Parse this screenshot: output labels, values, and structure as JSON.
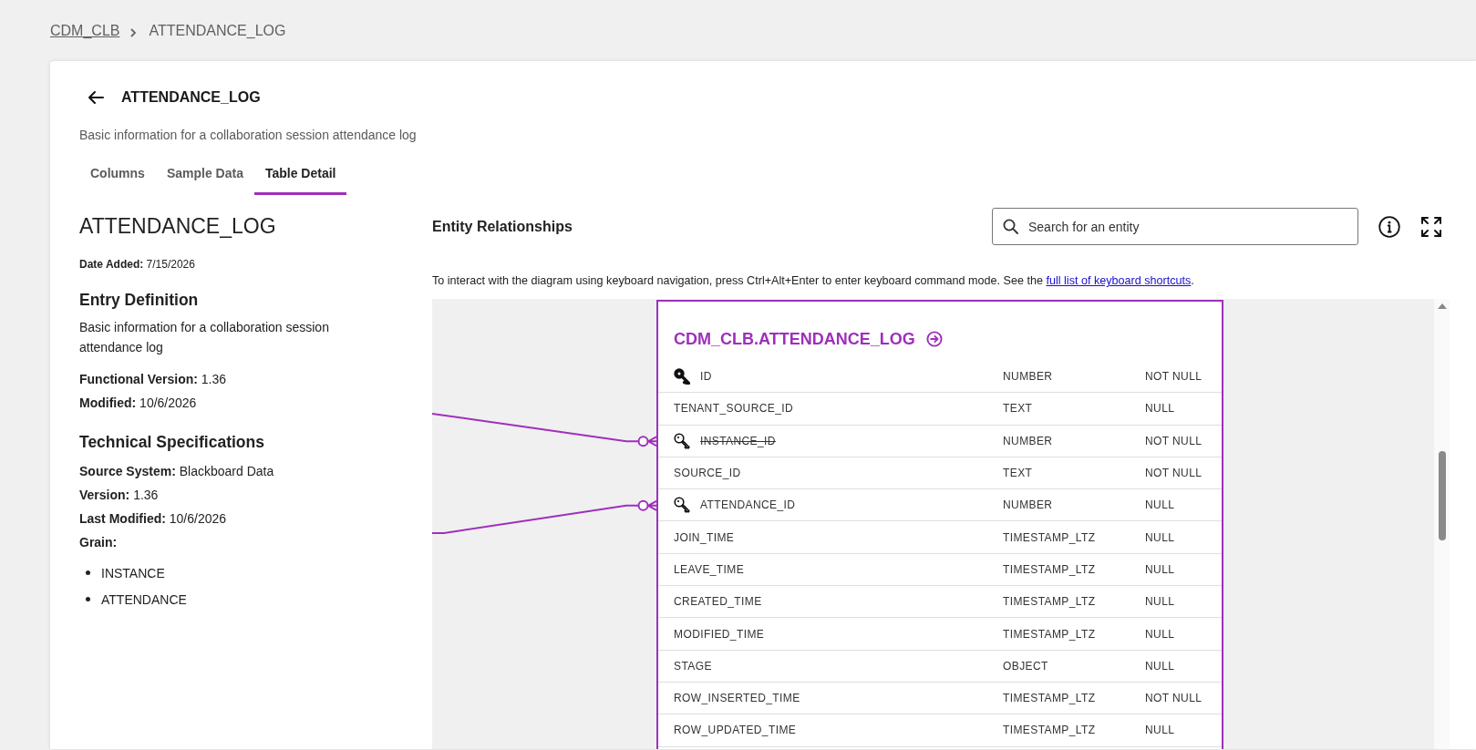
{
  "breadcrumb": [
    {
      "label": "CDM_CLB",
      "kind": "link"
    },
    {
      "label": "ATTENDANCE_LOG",
      "kind": "current"
    }
  ],
  "header": {
    "title": "ATTENDANCE_LOG",
    "description": "Basic information for a collaboration session attendance log"
  },
  "tabs": [
    {
      "label": "Columns",
      "selected": false
    },
    {
      "label": "Sample Data",
      "selected": false
    },
    {
      "label": "Table Detail",
      "selected": true
    }
  ],
  "details": {
    "title": "ATTENDANCE_LOG",
    "date_added": "**Date Added:** 7/15/2026",
    "sections": [
      {
        "heading": "Entry Definition",
        "description": "Basic information for a collaboration session attendance log",
        "fields": [
          "**Functional Version:** 1.36",
          "**Modified:** 10/6/2026"
        ]
      },
      {
        "heading": "Technical Specifications",
        "fields": [
          "**Source System:** Blackboard Data",
          "**Version:** 1.36",
          "**Last Modified:** 10/6/2026"
        ],
        "list_label": "Grain:",
        "list": [
          "INSTANCE",
          "ATTENDANCE"
        ]
      }
    ]
  },
  "entity_relationships": {
    "title": "Entity Relationships",
    "search": {
      "placeholder": "Search for an entity"
    },
    "instructions": "To interact with the diagram using keyboard navigation, press Ctrl+Alt+Enter to enter keyboard command mode. See the ",
    "instructions_link": "full list of keyboard shortcuts",
    "instructions_end": ".",
    "entity": {
      "title": "CDM_CLB.ATTENDANCE_LOG",
      "columns": [
        {
          "name": "ID",
          "type": "NUMBER",
          "nullability": "NOT NULL",
          "kind": "primary-key",
          "struck": false
        },
        {
          "name": "TENANT_SOURCE_ID",
          "type": "TEXT",
          "nullability": "NULL",
          "kind": "plain",
          "struck": false
        },
        {
          "name": "INSTANCE_ID",
          "type": "NUMBER",
          "nullability": "NOT NULL",
          "kind": "foreign-key",
          "struck": true
        },
        {
          "name": "SOURCE_ID",
          "type": "TEXT",
          "nullability": "NOT NULL",
          "kind": "plain",
          "struck": false
        },
        {
          "name": "ATTENDANCE_ID",
          "type": "NUMBER",
          "nullability": "NULL",
          "kind": "foreign-key",
          "struck": false
        },
        {
          "name": "JOIN_TIME",
          "type": "TIMESTAMP_LTZ",
          "nullability": "NULL",
          "kind": "plain",
          "struck": false
        },
        {
          "name": "LEAVE_TIME",
          "type": "TIMESTAMP_LTZ",
          "nullability": "NULL",
          "kind": "plain",
          "struck": false
        },
        {
          "name": "CREATED_TIME",
          "type": "TIMESTAMP_LTZ",
          "nullability": "NULL",
          "kind": "plain",
          "struck": false
        },
        {
          "name": "MODIFIED_TIME",
          "type": "TIMESTAMP_LTZ",
          "nullability": "NULL",
          "kind": "plain",
          "struck": false
        },
        {
          "name": "STAGE",
          "type": "OBJECT",
          "nullability": "NULL",
          "kind": "plain",
          "struck": false
        },
        {
          "name": "ROW_INSERTED_TIME",
          "type": "TIMESTAMP_LTZ",
          "nullability": "NOT NULL",
          "kind": "plain",
          "struck": false
        },
        {
          "name": "ROW_UPDATED_TIME",
          "type": "TIMESTAMP_LTZ",
          "nullability": "NULL",
          "kind": "plain",
          "struck": false
        }
      ]
    }
  }
}
